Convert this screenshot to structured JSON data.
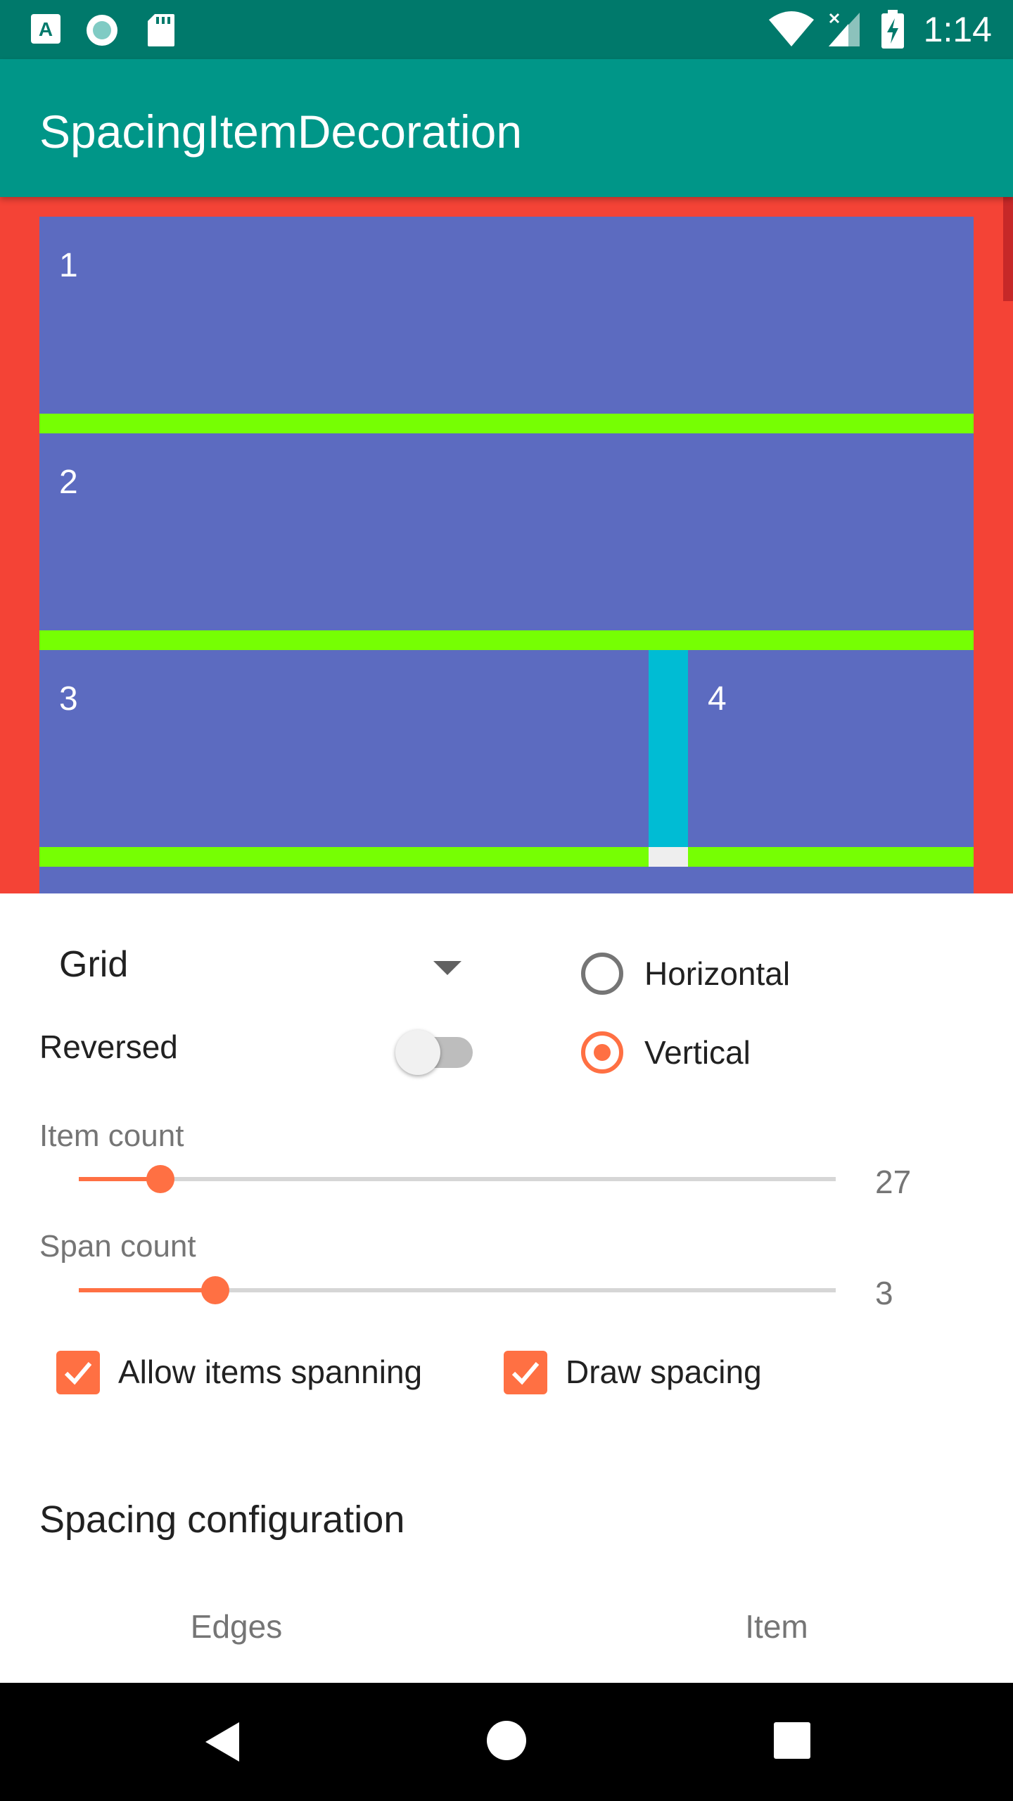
{
  "status_bar": {
    "time": "1:14",
    "left_icons": [
      "a-icon",
      "circle-icon",
      "sdcard-icon"
    ],
    "right_icons": [
      "wifi-icon",
      "signal-icon",
      "battery-charging-icon"
    ]
  },
  "app_bar": {
    "title": "SpacingItemDecoration"
  },
  "preview": {
    "items": [
      {
        "label": "1"
      },
      {
        "label": "2"
      },
      {
        "label": "3"
      },
      {
        "label": "4"
      }
    ],
    "colors": {
      "background": "#f44336",
      "item": "#5c6bc0",
      "horizontal_spacing": "#76ff03",
      "vertical_spacing": "#00bcd4"
    }
  },
  "controls": {
    "layout_select": {
      "value": "Grid"
    },
    "reversed": {
      "label": "Reversed",
      "checked": false
    },
    "orientation": {
      "options": [
        {
          "label": "Horizontal",
          "selected": false
        },
        {
          "label": "Vertical",
          "selected": true
        }
      ]
    },
    "item_count": {
      "label": "Item count",
      "value": "27"
    },
    "span_count": {
      "label": "Span count",
      "value": "3"
    },
    "allow_items_spanning": {
      "label": "Allow items spanning",
      "checked": true
    },
    "draw_spacing": {
      "label": "Draw spacing",
      "checked": true
    }
  },
  "spacing_configuration": {
    "title": "Spacing configuration",
    "tabs": [
      {
        "label": "Edges"
      },
      {
        "label": "Item"
      }
    ]
  },
  "nav_bar": {
    "icons": [
      "back-icon",
      "home-icon",
      "recents-icon"
    ]
  },
  "accent_color": "#ff7043"
}
